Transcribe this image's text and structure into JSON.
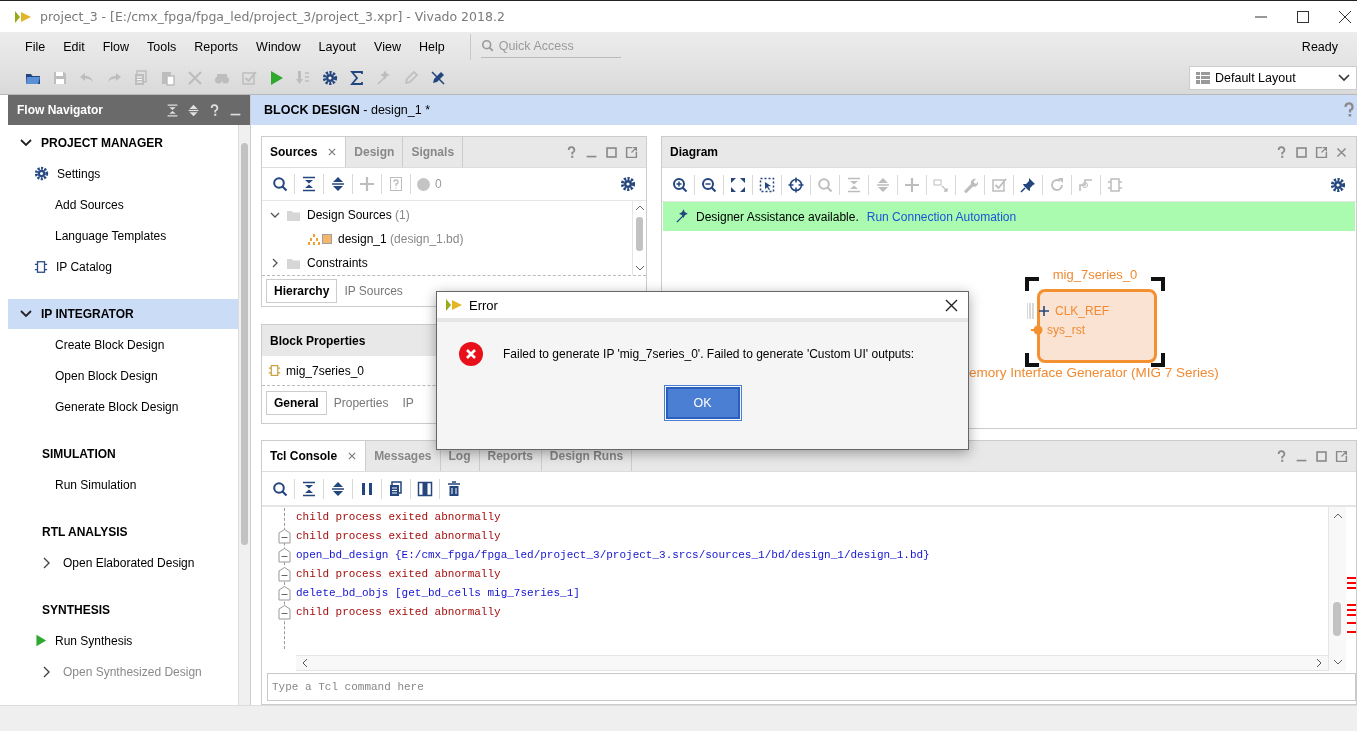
{
  "window": {
    "title": "project_3 - [E:/cmx_fpga/fpga_led/project_3/project_3.xpr] - Vivado 2018.2"
  },
  "menu": [
    {
      "label": "File"
    },
    {
      "label": "Edit"
    },
    {
      "label": "Flow"
    },
    {
      "label": "Tools"
    },
    {
      "label": "Reports"
    },
    {
      "label": "Window"
    },
    {
      "label": "Layout"
    },
    {
      "label": "View"
    },
    {
      "label": "Help"
    }
  ],
  "quick_access": {
    "placeholder": "Quick Access"
  },
  "status": "Ready",
  "toolbar": [
    {
      "kind": "open",
      "disabled": false
    },
    {
      "kind": "save",
      "disabled": true
    },
    {
      "kind": "undo",
      "disabled": true
    },
    {
      "kind": "redo",
      "disabled": true
    },
    {
      "kind": "copy",
      "disabled": true
    },
    {
      "kind": "paste",
      "disabled": true
    },
    {
      "kind": "delete",
      "disabled": true
    },
    {
      "kind": "find",
      "disabled": true
    },
    {
      "kind": "check",
      "disabled": true
    },
    {
      "kind": "run",
      "disabled": false
    },
    {
      "kind": "program",
      "disabled": true
    },
    {
      "kind": "settings",
      "disabled": false
    },
    {
      "kind": "sigma",
      "disabled": false
    },
    {
      "kind": "wand",
      "disabled": true
    },
    {
      "kind": "pen",
      "disabled": true
    },
    {
      "kind": "route",
      "disabled": false
    }
  ],
  "layout": {
    "value": "Default Layout"
  },
  "flow_navigator": {
    "title": "Flow Navigator",
    "sections": [
      {
        "title": "PROJECT MANAGER",
        "expanded": true,
        "selected": false,
        "items": [
          {
            "label": "Settings",
            "kind": "gear",
            "disabled": false
          },
          {
            "label": "Add Sources",
            "kind": "plain",
            "disabled": false
          },
          {
            "label": "Language Templates",
            "kind": "plain",
            "disabled": false
          },
          {
            "label": "IP Catalog",
            "kind": "ip",
            "disabled": false
          }
        ]
      },
      {
        "title": "IP INTEGRATOR",
        "expanded": true,
        "selected": true,
        "items": [
          {
            "label": "Create Block Design",
            "kind": "plain",
            "disabled": false
          },
          {
            "label": "Open Block Design",
            "kind": "plain",
            "disabled": false
          },
          {
            "label": "Generate Block Design",
            "kind": "plain",
            "disabled": false
          }
        ]
      },
      {
        "title": "SIMULATION",
        "selected": false,
        "items": [
          {
            "label": "Run Simulation",
            "kind": "plain",
            "disabled": false
          }
        ]
      },
      {
        "title": "RTL ANALYSIS",
        "selected": false,
        "items": [
          {
            "label": "Open Elaborated Design",
            "kind": "expander",
            "disabled": false
          }
        ]
      },
      {
        "title": "SYNTHESIS",
        "selected": false,
        "items": [
          {
            "label": "Run Synthesis",
            "kind": "run",
            "disabled": false
          },
          {
            "label": "Open Synthesized Design",
            "kind": "expander",
            "disabled": true
          }
        ]
      }
    ]
  },
  "block_design": {
    "title": "**BLOCK DESIGN** - design_1 *"
  },
  "sources": {
    "tabs": [
      {
        "label": "Sources",
        "selected": true
      },
      {
        "label": "Design",
        "selected": false
      },
      {
        "label": "Signals",
        "selected": false
      }
    ],
    "toolbar": [
      {
        "kind": "search",
        "disabled": false
      },
      {
        "kind": "collapse",
        "disabled": false
      },
      {
        "kind": "expand",
        "disabled": false
      },
      {
        "kind": "plus",
        "disabled": true
      },
      {
        "kind": "doc",
        "disabled": true
      }
    ],
    "count": "0",
    "tree": [
      {
        "label": "Design Sources",
        "suffix": "(1)",
        "kind": "folder",
        "expanded": true,
        "children": [
          {
            "label": "design_1",
            "suffix": "(design_1.bd)",
            "kind": "bd"
          }
        ]
      },
      {
        "label": "Constraints",
        "kind": "folder",
        "expanded": false
      }
    ],
    "bottom_tabs": [
      {
        "label": "Hierarchy",
        "selected": true
      },
      {
        "label": "IP Sources",
        "selected": false
      }
    ]
  },
  "block_properties": {
    "title": "Block Properties",
    "item": "mig_7series_0",
    "tabs": [
      {
        "label": "General",
        "selected": true
      },
      {
        "label": "Properties",
        "selected": false
      },
      {
        "label": "IP",
        "selected": false
      }
    ]
  },
  "diagram": {
    "title": "Diagram",
    "toolbar": [
      {
        "kind": "zoom-in",
        "disabled": false
      },
      {
        "kind": "zoom-out",
        "disabled": false
      },
      {
        "kind": "fit",
        "disabled": false
      },
      {
        "kind": "select",
        "disabled": false
      },
      {
        "kind": "target",
        "disabled": false
      },
      {
        "kind": "search",
        "disabled": true
      },
      {
        "kind": "collapse",
        "disabled": true
      },
      {
        "kind": "expand",
        "disabled": true
      },
      {
        "kind": "plus",
        "disabled": true
      },
      {
        "kind": "port",
        "disabled": true
      },
      {
        "kind": "wrench",
        "disabled": true
      },
      {
        "kind": "check",
        "disabled": true
      },
      {
        "kind": "pin",
        "disabled": false
      },
      {
        "kind": "refresh",
        "disabled": true
      },
      {
        "kind": "reroute",
        "disabled": true
      },
      {
        "kind": "ip",
        "disabled": true
      }
    ],
    "banner": {
      "text": "Designer Assistance available.",
      "link": "Run Connection Automation"
    },
    "block": {
      "name": "mig_7series_0",
      "selected": true,
      "ports": [
        {
          "label": "CLK_REF",
          "kind": "bus"
        },
        {
          "label": "sys_rst",
          "kind": "pin"
        }
      ],
      "caption": "emory Interface Generator (MIG 7 Series)"
    }
  },
  "tcl_console": {
    "tabs": [
      {
        "label": "Tcl Console",
        "selected": true
      },
      {
        "label": "Messages",
        "selected": false
      },
      {
        "label": "Log",
        "selected": false
      },
      {
        "label": "Reports",
        "selected": false
      },
      {
        "label": "Design Runs",
        "selected": false
      }
    ],
    "toolbar": [
      {
        "kind": "search",
        "disabled": false
      },
      {
        "kind": "collapse",
        "disabled": false
      },
      {
        "kind": "expand",
        "disabled": false
      },
      {
        "kind": "pause",
        "disabled": false
      },
      {
        "kind": "copy",
        "disabled": false
      },
      {
        "kind": "columns",
        "disabled": false
      },
      {
        "kind": "trash",
        "disabled": false
      }
    ],
    "lines": [
      {
        "text": "child process exited abnormally",
        "kind": "error",
        "fold": false
      },
      {
        "text": "child process exited abnormally",
        "kind": "error",
        "fold": true
      },
      {
        "text": "open_bd_design {E:/cmx_fpga/fpga_led/project_3/project_3.srcs/sources_1/bd/design_1/design_1.bd}",
        "kind": "command",
        "fold": true
      },
      {
        "text": "child process exited abnormally",
        "kind": "error",
        "fold": true
      },
      {
        "text": "delete_bd_objs [get_bd_cells mig_7series_1]",
        "kind": "command",
        "fold": true
      },
      {
        "text": "child process exited abnormally",
        "kind": "error",
        "fold": true
      }
    ],
    "placeholder": "Type a Tcl command here"
  },
  "dialog": {
    "title": "Error",
    "message": "Failed to generate IP 'mig_7series_0'. Failed to generate 'Custom UI' outputs:",
    "button": "OK"
  }
}
